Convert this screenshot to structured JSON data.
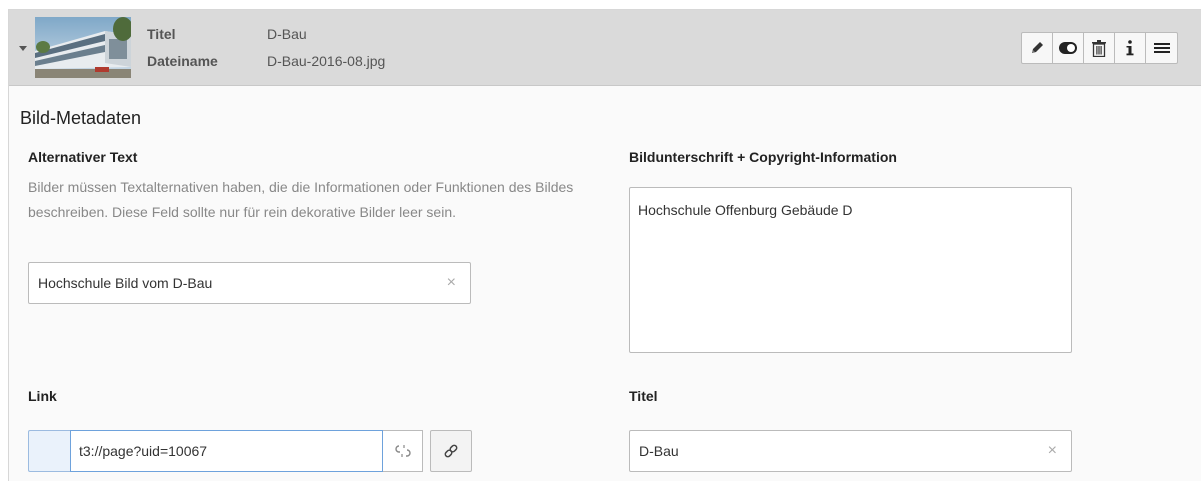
{
  "header": {
    "thumbnail_icon": "building-photo-thumbnail",
    "title_label": "Titel",
    "title_value": "D-Bau",
    "filename_label": "Dateiname",
    "filename_value": "D-Bau-2016-08.jpg",
    "buttons": [
      "edit-icon",
      "toggle-visibility-icon",
      "delete-icon",
      "info-icon",
      "drag-handle-icon"
    ]
  },
  "section": {
    "title": "Bild-Metadaten"
  },
  "alt_text": {
    "label": "Alternativer Text",
    "description": "Bilder müssen Textalternativen haben, die die Informationen oder Funktionen des Bildes beschreiben. Diese Feld sollte nur für rein dekorative Bilder leer sein.",
    "value": "Hochschule Bild vom D-Bau",
    "clear": "×"
  },
  "caption": {
    "label": "Bildunterschrift + Copyright-Information",
    "value": "Hochschule Offenburg Gebäude D"
  },
  "link": {
    "label": "Link",
    "value": "t3://page?uid=10067"
  },
  "title_field": {
    "label": "Titel",
    "value": "D-Bau",
    "clear": "×"
  },
  "colors": {
    "header_bg": "#dadada",
    "panel_bg": "#fafafa",
    "focus_border": "#6ea2dc",
    "addon_bg": "#eaf2fb"
  }
}
